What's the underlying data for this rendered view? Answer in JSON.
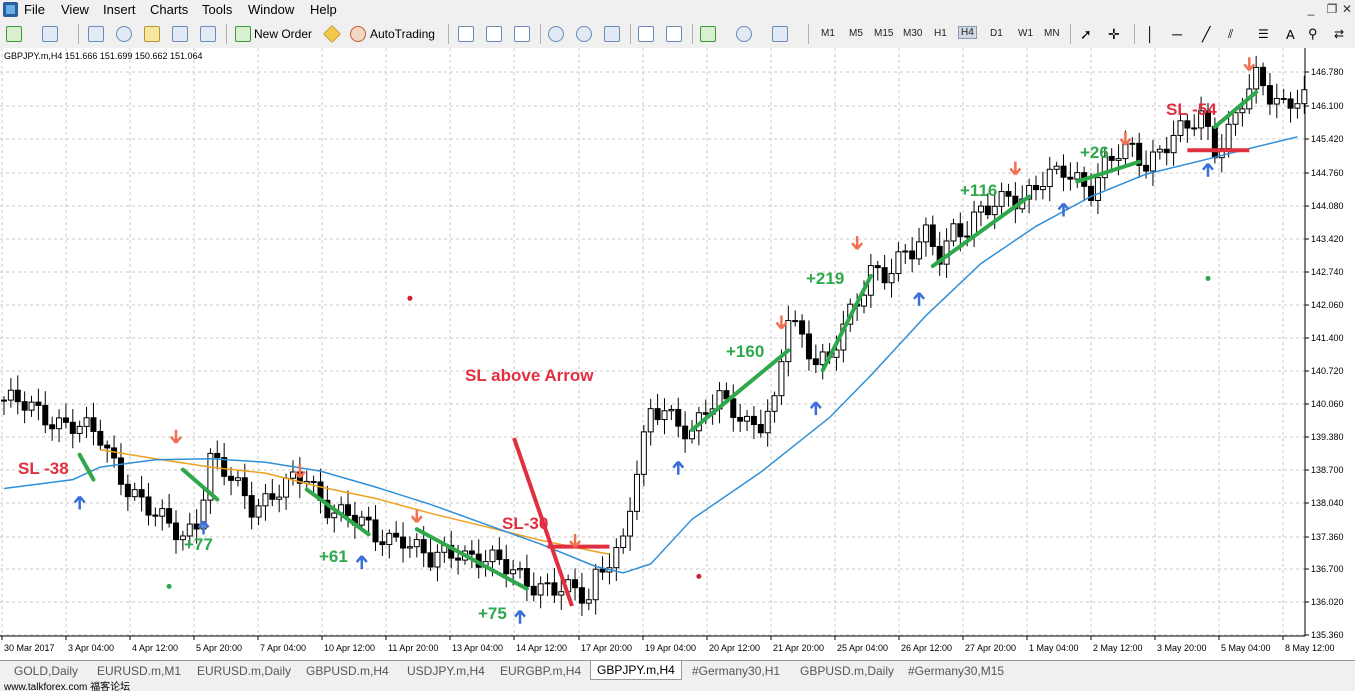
{
  "menu": [
    "File",
    "View",
    "Insert",
    "Charts",
    "Tools",
    "Window",
    "Help"
  ],
  "toolbar": {
    "new_order": "New Order",
    "autotrading": "AutoTrading",
    "timeframes": [
      "M1",
      "M5",
      "M15",
      "M30",
      "H1",
      "H4",
      "D1",
      "W1",
      "MN"
    ],
    "active_timeframe": "H4"
  },
  "chart_header": "GBPJPY.m,H4  151.666 151.699 150.662 151.064",
  "chart_data": {
    "type": "candlestick",
    "symbol": "GBPJPY.m",
    "timeframe": "H4",
    "ylim": [
      135.6,
      147.0
    ],
    "y_ticks": [
      "146.780",
      "146.100",
      "145.420",
      "144.760",
      "144.080",
      "143.420",
      "142.740",
      "142.060",
      "141.400",
      "140.720",
      "140.060",
      "139.380",
      "138.700",
      "138.040",
      "137.360",
      "136.700",
      "136.020",
      "135.360"
    ],
    "x_ticks": [
      "30 Mar 2017",
      "3 Apr 04:00",
      "4 Apr 12:00",
      "5 Apr 20:00",
      "7 Apr 04:00",
      "10 Apr 12:00",
      "11 Apr 20:00",
      "13 Apr 04:00",
      "14 Apr 12:00",
      "17 Apr 20:00",
      "19 Apr 04:00",
      "20 Apr 12:00",
      "21 Apr 20:00",
      "25 Apr 04:00",
      "26 Apr 12:00",
      "27 Apr 20:00",
      "1 May 04:00",
      "2 May 12:00",
      "3 May 20:00",
      "5 May 04:00",
      "8 May 12:00"
    ],
    "close_path": [
      [
        0,
        139.9
      ],
      [
        6,
        139.6
      ],
      [
        10,
        139.4
      ],
      [
        14,
        139.1
      ],
      [
        18,
        138.2
      ],
      [
        22,
        137.5
      ],
      [
        26,
        137.2
      ],
      [
        28,
        137.5
      ],
      [
        30,
        138.7
      ],
      [
        32,
        138.4
      ],
      [
        36,
        137.8
      ],
      [
        40,
        138.1
      ],
      [
        44,
        138.3
      ],
      [
        46,
        137.9
      ],
      [
        50,
        137.6
      ],
      [
        54,
        137.1
      ],
      [
        58,
        137.2
      ],
      [
        62,
        136.6
      ],
      [
        66,
        136.9
      ],
      [
        70,
        136.7
      ],
      [
        74,
        136.4
      ],
      [
        78,
        136.2
      ],
      [
        82,
        136.0
      ],
      [
        85,
        135.9
      ],
      [
        86,
        136.4
      ],
      [
        88,
        136.8
      ],
      [
        90,
        137.0
      ],
      [
        92,
        138.4
      ],
      [
        94,
        139.6
      ],
      [
        96,
        139.8
      ],
      [
        98,
        139.5
      ],
      [
        100,
        139.2
      ],
      [
        102,
        139.6
      ],
      [
        104,
        139.9
      ],
      [
        106,
        139.8
      ],
      [
        108,
        139.5
      ],
      [
        110,
        139.4
      ],
      [
        112,
        139.7
      ],
      [
        114,
        141.6
      ],
      [
        116,
        141.2
      ],
      [
        118,
        140.8
      ],
      [
        120,
        140.7
      ],
      [
        122,
        141.3
      ],
      [
        124,
        141.8
      ],
      [
        126,
        142.6
      ],
      [
        128,
        142.5
      ],
      [
        130,
        142.7
      ],
      [
        132,
        142.8
      ],
      [
        134,
        143.2
      ],
      [
        136,
        142.9
      ],
      [
        138,
        143.4
      ],
      [
        140,
        143.3
      ],
      [
        142,
        143.6
      ],
      [
        144,
        143.8
      ],
      [
        146,
        144.1
      ],
      [
        148,
        144.0
      ],
      [
        150,
        144.2
      ],
      [
        152,
        144.3
      ],
      [
        154,
        144.5
      ],
      [
        156,
        144.4
      ],
      [
        158,
        144.2
      ],
      [
        160,
        144.6
      ],
      [
        162,
        144.8
      ],
      [
        164,
        144.9
      ],
      [
        166,
        144.7
      ],
      [
        168,
        145.0
      ],
      [
        170,
        145.2
      ],
      [
        172,
        145.3
      ],
      [
        174,
        145.6
      ],
      [
        176,
        145.0
      ],
      [
        178,
        145.4
      ],
      [
        180,
        145.9
      ],
      [
        182,
        146.3
      ],
      [
        184,
        146.0
      ],
      [
        186,
        145.9
      ],
      [
        188,
        146.1
      ],
      [
        190,
        146.0
      ],
      [
        192,
        146.4
      ]
    ],
    "series": [
      {
        "name": "orange moving average",
        "color": "#f0a020",
        "points": [
          [
            14,
            138.9
          ],
          [
            22,
            138.72
          ],
          [
            30,
            138.55
          ],
          [
            38,
            138.43
          ],
          [
            46,
            138.15
          ],
          [
            54,
            137.92
          ],
          [
            62,
            137.62
          ],
          [
            70,
            137.35
          ],
          [
            78,
            137.08
          ],
          [
            86,
            136.85
          ],
          [
            88,
            136.8
          ]
        ]
      },
      {
        "name": "blue moving average",
        "color": "#2f8fd8",
        "points": [
          [
            0,
            138.12
          ],
          [
            10,
            138.3
          ],
          [
            14,
            138.55
          ],
          [
            22,
            138.7
          ],
          [
            30,
            138.72
          ],
          [
            38,
            138.65
          ],
          [
            46,
            138.47
          ],
          [
            54,
            138.15
          ],
          [
            62,
            137.8
          ],
          [
            70,
            137.4
          ],
          [
            78,
            137.0
          ],
          [
            86,
            136.55
          ],
          [
            90,
            136.42
          ],
          [
            94,
            136.6
          ],
          [
            100,
            137.5
          ],
          [
            110,
            138.45
          ],
          [
            120,
            139.55
          ],
          [
            126,
            140.4
          ],
          [
            134,
            141.6
          ],
          [
            142,
            142.65
          ],
          [
            150,
            143.4
          ],
          [
            158,
            144.0
          ],
          [
            166,
            144.45
          ],
          [
            174,
            144.72
          ],
          [
            182,
            145.0
          ],
          [
            188,
            145.2
          ]
        ]
      }
    ],
    "annotations": [
      {
        "text": "SL -38",
        "color": "#e03040"
      },
      {
        "text": "+77",
        "color": "#2ea84a"
      },
      {
        "text": "+61",
        "color": "#2ea84a"
      },
      {
        "text": "+75",
        "color": "#2ea84a"
      },
      {
        "text": "SL-30",
        "color": "#e03040"
      },
      {
        "text": "SL above Arrow",
        "color": "#e03040"
      },
      {
        "text": "+160",
        "color": "#2ea84a"
      },
      {
        "text": "+219",
        "color": "#2ea84a"
      },
      {
        "text": "+116",
        "color": "#2ea84a"
      },
      {
        "text": "+26",
        "color": "#2ea84a"
      },
      {
        "text": "SL -54",
        "color": "#e03040"
      }
    ],
    "trade_lines_color": "#2ea84a",
    "stop_lines_color": "#e03040",
    "up_arrow_color": "#3a6ed8",
    "down_arrow_color": "#f07050",
    "grid": true
  },
  "tabs": [
    "GOLD,Daily",
    "EURUSD.m,M1",
    "EURUSD.m,Daily",
    "GBPUSD.m,H4",
    "USDJPY.m,H4",
    "EURGBP.m,H4",
    "GBPJPY.m,H4",
    "#Germany30,H1",
    "GBPUSD.m,Daily",
    "#Germany30,M15"
  ],
  "active_tab": "GBPJPY.m,H4",
  "watermark": "www.talkforex.com 福客论坛"
}
